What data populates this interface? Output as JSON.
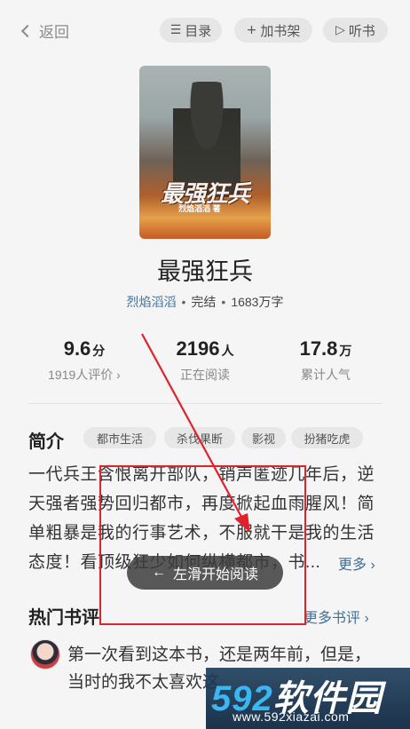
{
  "topbar": {
    "back_label": "返回",
    "toc_label": "目录",
    "shelf_label": "加书架",
    "listen_label": "听书"
  },
  "cover": {
    "title_art": "最强狂兵",
    "author_art": "烈焰滔滔 著"
  },
  "book": {
    "title": "最强狂兵",
    "author": "烈焰滔滔",
    "status": "完结",
    "word_count": "1683万字"
  },
  "stats": {
    "rating_value": "9.6",
    "rating_unit": "分",
    "rating_label": "1919人评价 ›",
    "reading_value": "2196",
    "reading_unit": "人",
    "reading_label": "正在阅读",
    "popularity_value": "17.8",
    "popularity_unit": "万",
    "popularity_label": "累计人气"
  },
  "intro": {
    "title": "简介",
    "tags": [
      "都市生活",
      "杀伐果断",
      "影视",
      "扮猪吃虎"
    ],
    "text": "一代兵王含恨离开部队，销声匿迹几年后，逆天强者强势回归都市，再度掀起血雨腥风！简单粗暴是我的行事艺术，不服就干是我的生活态度！看顶级狂少如何纵横都市，书...",
    "more_label": "更多 ›"
  },
  "toast": {
    "label": "左滑开始阅读"
  },
  "reviews": {
    "title": "热门书评",
    "more_label": "更多书评 ›",
    "first_text": "第一次看到这本书，还是两年前，但是，当时的我不太喜欢这"
  },
  "watermark": {
    "brand_numbers": "592",
    "brand_text": "软件园",
    "url": "www.592xiazai.com"
  },
  "colors": {
    "link": "#3f6f9a",
    "annotation": "#e0222c",
    "background": "#f5f5f5"
  }
}
